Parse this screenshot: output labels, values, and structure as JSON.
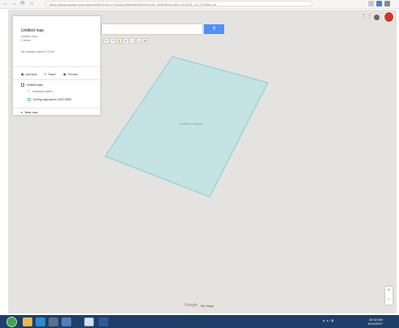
{
  "browser": {
    "back_label": "←",
    "forward_label": "→",
    "reload_label": "⟳",
    "home_label": "⌂",
    "address": "https://www.google.com/maps/d/edit?mid=1Tx2AqLvS8kWmGdRz6mVqN_3ZbHf9YpLc&ll=33.4523,-112.0736&z=18"
  },
  "panel": {
    "title": "Untitled map",
    "subtitle_1": "Untitled map",
    "subtitle_2": "0 views",
    "subtitle_3": "All changes saved in Drive",
    "actions": [
      "Add layer",
      "Share",
      "Preview"
    ],
    "layer_name": "Untitled layer",
    "layer_style": "Individual styles",
    "layer_item": "Zoning map parcel 2024 ZN05",
    "base_map": "Base map"
  },
  "search": {
    "placeholder": "",
    "button_icon": "search-icon"
  },
  "toolbar": {
    "buttons": [
      "↶",
      "↷",
      "✋",
      "⌖",
      "⌇",
      "▭",
      "⊞"
    ]
  },
  "polygon": {
    "label": "Untitled polygon",
    "fill_color": "#bfe3e5",
    "stroke_color": "#9fd3d8"
  },
  "map": {
    "background": "#e5e3df",
    "zoom_in": "+",
    "zoom_out": "−",
    "logo": "Google",
    "credit": "My Maps"
  },
  "taskbar": {
    "tray_text": "▲ ◂ ⌂ ▮",
    "time": "10:42 AM",
    "date": "6/14/2017"
  }
}
